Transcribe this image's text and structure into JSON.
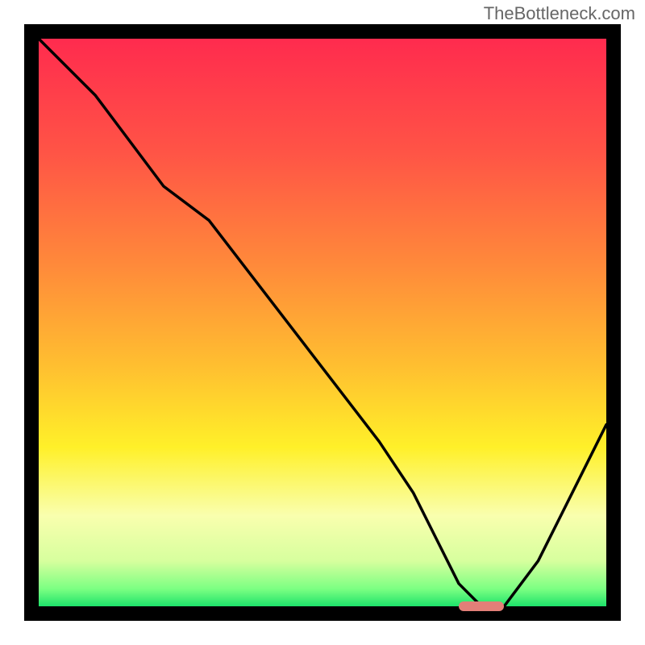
{
  "watermark": "TheBottleneck.com",
  "chart_data": {
    "type": "line",
    "title": "",
    "xlabel": "",
    "ylabel": "",
    "xlim": [
      0,
      100
    ],
    "ylim": [
      0,
      100
    ],
    "grid": false,
    "series": [
      {
        "name": "bottleneck-curve",
        "x": [
          0,
          10,
          22,
          30,
          40,
          50,
          60,
          66,
          70,
          74,
          78,
          82,
          88,
          94,
          100
        ],
        "y": [
          100,
          90,
          74,
          68,
          55,
          42,
          29,
          20,
          12,
          4,
          0,
          0,
          8,
          20,
          32
        ]
      }
    ],
    "annotations": [
      {
        "name": "optimal-marker",
        "x_start": 74,
        "x_end": 82,
        "y": 0,
        "color": "#e37f78"
      }
    ],
    "gradient_stops": [
      {
        "offset": 0.0,
        "color": "#ff2b4e"
      },
      {
        "offset": 0.2,
        "color": "#ff5446"
      },
      {
        "offset": 0.4,
        "color": "#ff8a3a"
      },
      {
        "offset": 0.58,
        "color": "#ffc030"
      },
      {
        "offset": 0.72,
        "color": "#fff029"
      },
      {
        "offset": 0.84,
        "color": "#f9ffae"
      },
      {
        "offset": 0.92,
        "color": "#d7ff9e"
      },
      {
        "offset": 0.97,
        "color": "#7aff82"
      },
      {
        "offset": 1.0,
        "color": "#1de26a"
      }
    ]
  }
}
